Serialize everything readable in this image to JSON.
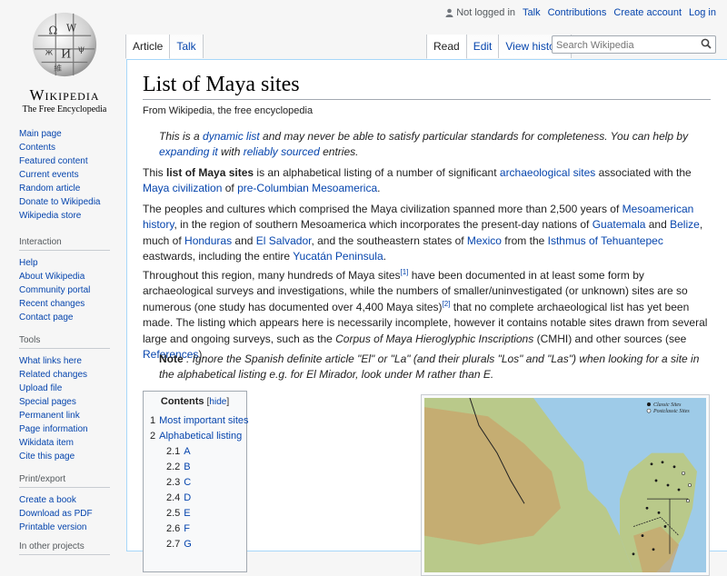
{
  "header": {
    "user_status": "Not logged in",
    "links": [
      "Talk",
      "Contributions",
      "Create account",
      "Log in"
    ]
  },
  "logo": {
    "wordmark": "Wikipedia",
    "tagline": "The Free Encyclopedia"
  },
  "tabs": {
    "left": [
      {
        "label": "Article",
        "selected": true
      },
      {
        "label": "Talk",
        "selected": false
      }
    ],
    "right": [
      {
        "label": "Read",
        "selected": true
      },
      {
        "label": "Edit",
        "selected": false
      },
      {
        "label": "View history",
        "selected": false
      }
    ]
  },
  "search": {
    "placeholder": "Search Wikipedia",
    "icon": "search-icon"
  },
  "sidebar": {
    "main": [
      "Main page",
      "Contents",
      "Featured content",
      "Current events",
      "Random article",
      "Donate to Wikipedia",
      "Wikipedia store"
    ],
    "interaction": {
      "title": "Interaction",
      "items": [
        "Help",
        "About Wikipedia",
        "Community portal",
        "Recent changes",
        "Contact page"
      ]
    },
    "tools": {
      "title": "Tools",
      "items": [
        "What links here",
        "Related changes",
        "Upload file",
        "Special pages",
        "Permanent link",
        "Page information",
        "Wikidata item",
        "Cite this page"
      ]
    },
    "print": {
      "title": "Print/export",
      "items": [
        "Create a book",
        "Download as PDF",
        "Printable version"
      ]
    },
    "other": {
      "title": "In other projects"
    }
  },
  "article": {
    "title": "List of Maya sites",
    "sitesub": "From Wikipedia, the free encyclopedia",
    "hatnote": {
      "t1": "This is a ",
      "l1": "dynamic list",
      "t2": " and may never be able to satisfy particular standards for completeness. You can help by ",
      "l2": "expanding it",
      "t3": " with ",
      "l3": "reliably sourced",
      "t4": " entries."
    },
    "p1": {
      "t1": "This ",
      "b1": "list of Maya sites",
      "t2": " is an alphabetical listing of a number of significant ",
      "l1": "archaeological sites",
      "t3": " associated with the ",
      "l2": "Maya civilization",
      "t4": " of ",
      "l3": "pre-Columbian Mesoamerica",
      "t5": "."
    },
    "p2": {
      "t1": "The peoples and cultures which comprised the Maya civilization spanned more than 2,500 years of ",
      "l1": "Mesoamerican history",
      "t2": ", in the region of southern Mesoamerica which incorporates the present-day nations of ",
      "l2": "Guatemala",
      "t3": " and ",
      "l3": "Belize",
      "t4": ", much of ",
      "l4": "Honduras",
      "t5": " and ",
      "l5": "El Salvador",
      "t6": ", and the southeastern states of ",
      "l6": "Mexico",
      "t7": " from the ",
      "l7": "Isthmus of Tehuantepec",
      "t8": " eastwards, including the entire ",
      "l8": "Yucatán Peninsula",
      "t9": "."
    },
    "p3": {
      "t1": "Throughout this region, many hundreds of Maya sites",
      "s1": "[1]",
      "t2": " have been documented in at least some form by archaeological surveys and investigations, while the numbers of smaller/uninvestigated (or unknown) sites are so numerous (one study has documented over 4,400 Maya sites)",
      "s2": "[2]",
      "t3": " that no complete archaeological list has yet been made. The listing which appears here is necessarily incomplete, however it contains notable sites drawn from several large and ongoing surveys, such as the ",
      "i1": "Corpus of Maya Hieroglyphic Inscriptions",
      "t4": " (CMHI) and other sources (see ",
      "l1": "References",
      "t5": ")."
    },
    "note": {
      "b1": "Note",
      "t1": " : Ignore the Spanish definite article \"El\" or \"La\" (and their plurals \"Los\" and \"Las\") when looking for a site in the alphabetical listing e.g. for El Mirador, look under M rather than E."
    }
  },
  "toc": {
    "title": "Contents",
    "hide": "hide",
    "items": [
      {
        "num": "1",
        "label": "Most important sites",
        "level": 1
      },
      {
        "num": "2",
        "label": "Alphabetical listing",
        "level": 1
      },
      {
        "num": "2.1",
        "label": "A",
        "level": 2
      },
      {
        "num": "2.2",
        "label": "B",
        "level": 2
      },
      {
        "num": "2.3",
        "label": "C",
        "level": 2
      },
      {
        "num": "2.4",
        "label": "D",
        "level": 2
      },
      {
        "num": "2.5",
        "label": "E",
        "level": 2
      },
      {
        "num": "2.6",
        "label": "F",
        "level": 2
      },
      {
        "num": "2.7",
        "label": "G",
        "level": 2
      }
    ]
  },
  "map": {
    "legend": [
      "Classic Sites",
      "Postclassic Sites"
    ],
    "colors": {
      "sea": "#9ecbe8",
      "land": "#b9c98a",
      "highland": "#c9a36a",
      "border": "#222222",
      "classic_dot": "#1a1a1a",
      "postclassic_dot": "#ffffff"
    }
  },
  "colors": {
    "link": "#0645ad",
    "content_border": "#a7d7f9",
    "background": "#f6f6f6"
  }
}
